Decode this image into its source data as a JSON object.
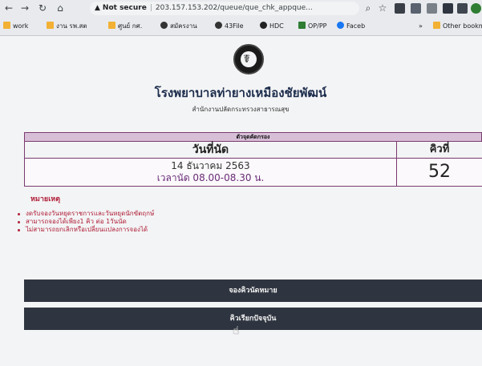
{
  "browser": {
    "back_icon": "back-arrow-icon",
    "forward_icon": "forward-arrow-icon",
    "reload_icon": "reload-icon",
    "home_icon": "home-icon",
    "security_label": "Not secure",
    "url": "203.157.153.202/queue/que_chk_appque...",
    "bookmarks": [
      "work",
      "งาน รพ.สต",
      "ศูนย์ กศ.",
      "สมัครงาน",
      "43File",
      "HDC",
      "OP/PP",
      "Faceb"
    ],
    "other_bookmarks": "Other bookma",
    "more": "»"
  },
  "page": {
    "title": "โรงพยาบาลท่ายางเหมืองชัยพัฒน์",
    "subtitle": "สำนักงานปลัดกระทรวงสาธารณสุข",
    "table_band": "ตัวจุดคัดกรอง",
    "col_date_header": "วันที่นัด",
    "col_queue_header": "คิวที่",
    "date_value": "14 ธันวาคม 2563",
    "time_value": "เวลานัด 08.00-08.30 น.",
    "queue_value": "52",
    "notes_title": "หมายเหตุ",
    "notes": [
      "งดรับจองวันหยุดราชการและวันหยุดนักขัตฤกษ์",
      "สามารถจองได้เพียง1 คิว ต่อ 1วันนัด",
      "ไม่สามารถยกเลิกหรือเปลี่ยนแปลงการจองได้"
    ],
    "btn_book": "จองคิวนัดหมาย",
    "btn_current": "คิวเรียกปัจจุบัน"
  },
  "colors": {
    "band_bg": "#d8bfd8",
    "border": "#7a3a6f",
    "button_bg": "#2f3540",
    "note_red": "#b0203a"
  }
}
